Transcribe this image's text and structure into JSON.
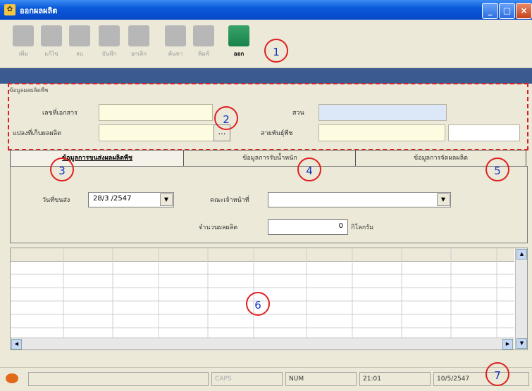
{
  "window": {
    "title": "ออกผลผลิต"
  },
  "toolbar": {
    "buttons": [
      {
        "label": "เพิ่ม",
        "icon": "add-icon",
        "enabled": false
      },
      {
        "label": "แก้ไข",
        "icon": "edit-icon",
        "enabled": false
      },
      {
        "label": "ลบ",
        "icon": "delete-icon",
        "enabled": false
      },
      {
        "label": "บันทึก",
        "icon": "save-icon",
        "enabled": false
      },
      {
        "label": "ยกเลิก",
        "icon": "cancel-icon",
        "enabled": false
      },
      {
        "label": "ค้นหา",
        "icon": "search-icon",
        "enabled": false
      },
      {
        "label": "พิมพ์",
        "icon": "print-icon",
        "enabled": false
      },
      {
        "label": "ออก",
        "icon": "exit-icon",
        "enabled": true
      }
    ]
  },
  "header_group": {
    "title": "ข้อมูลผลผลิตพืช",
    "doc_no_label": "เลขที่เอกสาร",
    "doc_no_value": "",
    "zone_label": "สวน",
    "zone_value": "",
    "plot_label": "แปลงที่เก็บผลผลิต",
    "plot_value": "",
    "breed_label": "สายพันธุ์พืช",
    "breed_value": "",
    "extra_value": ""
  },
  "tabs": [
    {
      "label": "ข้อมูลการขนส่งผลผลิตพืช",
      "selected": true
    },
    {
      "label": "ข้อมูลการรับน้ำหนัก",
      "selected": false
    },
    {
      "label": "ข้อมูลการจัดผลผลิต",
      "selected": false
    }
  ],
  "tab_panel": {
    "date_label": "วันที่ขนส่ง",
    "date_value": "28/3 /2547",
    "staff_label": "คณะเจ้าหน้าที่",
    "staff_value": "",
    "qty_label": "จำนวนผลผลิต",
    "qty_value": "0",
    "qty_unit": "กิโลกรัม"
  },
  "status_bar": {
    "caps": "CAPS",
    "num": "NUM",
    "time": "21:01",
    "date": "10/5/2547"
  },
  "callouts": [
    "1",
    "2",
    "3",
    "4",
    "5",
    "6",
    "7"
  ],
  "colors": {
    "title_bar": "#0a5ad9",
    "callout": "#e02020",
    "yellow_field": "#fdfbe0",
    "blue_field": "#dce8f8"
  }
}
